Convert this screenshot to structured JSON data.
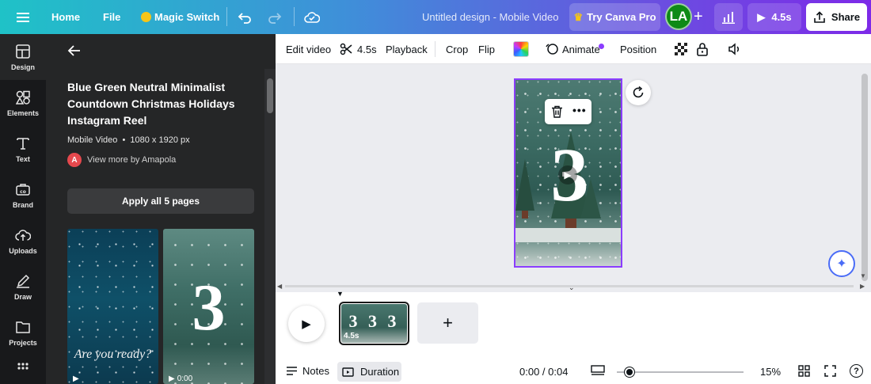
{
  "header": {
    "home": "Home",
    "file": "File",
    "magic_switch": "Magic Switch",
    "doc_title": "Untitled design - Mobile Video",
    "try_pro": "Try Canva Pro",
    "avatar": "LA",
    "play_duration": "4.5s",
    "share": "Share"
  },
  "rail": {
    "items": [
      {
        "label": "Design",
        "icon": "design-icon"
      },
      {
        "label": "Elements",
        "icon": "elements-icon"
      },
      {
        "label": "Text",
        "icon": "text-icon"
      },
      {
        "label": "Brand",
        "icon": "brand-icon"
      },
      {
        "label": "Uploads",
        "icon": "uploads-icon"
      },
      {
        "label": "Draw",
        "icon": "draw-icon"
      },
      {
        "label": "Projects",
        "icon": "projects-icon"
      }
    ]
  },
  "panel": {
    "template_title": "Blue Green Neutral Minimalist Countdown Christmas Holidays Instagram Reel",
    "meta_type": "Mobile Video",
    "meta_size": "1080 x 1920 px",
    "author_initial": "A",
    "author_link": "View more by Amapola",
    "apply_button": "Apply all 5 pages",
    "thumb1_text": "Are you ready?",
    "thumb2_text": "3",
    "thumb2_time": "0:00"
  },
  "toolbar": {
    "edit_video": "Edit video",
    "duration": "4.5s",
    "playback": "Playback",
    "crop": "Crop",
    "flip": "Flip",
    "animate": "Animate",
    "position": "Position"
  },
  "canvas": {
    "big_number": "3"
  },
  "timeline": {
    "clip_text": "3 3 3",
    "clip_duration": "4.5s",
    "notes": "Notes",
    "duration_btn": "Duration",
    "time": "0:00 / 0:04",
    "zoom": "15%",
    "zoom_level": 0.1
  },
  "colors": {
    "accent": "#7d2ae8",
    "selection": "#8b3dff",
    "avatar_bg": "#0e8a16"
  }
}
